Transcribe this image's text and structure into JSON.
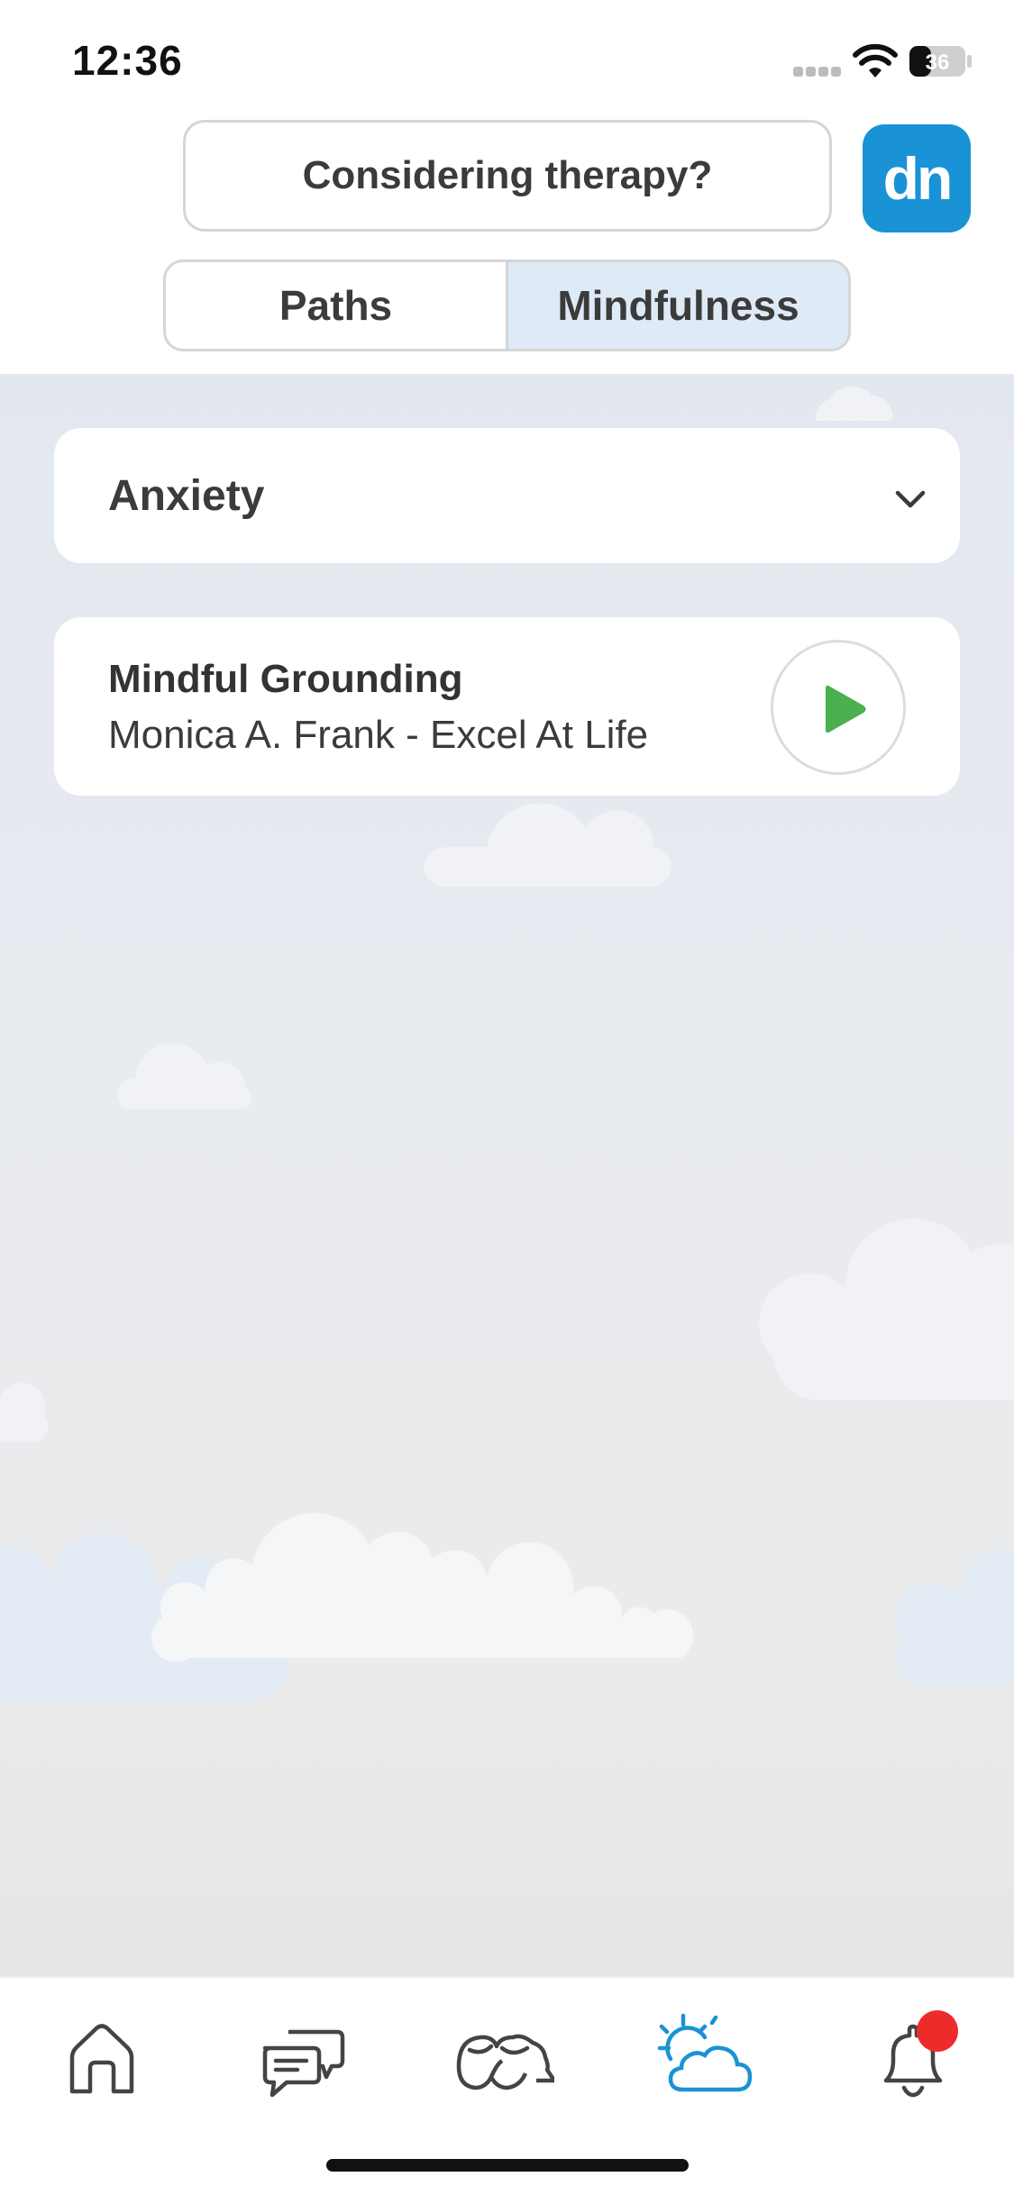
{
  "status_bar": {
    "time": "12:36",
    "battery": "36"
  },
  "header": {
    "therapy_button": "Considering therapy?",
    "logo_text": "dn",
    "logo_color": "#1a92d6"
  },
  "segments": [
    {
      "label": "Paths",
      "active": false
    },
    {
      "label": "Mindfulness",
      "active": true
    }
  ],
  "filter": {
    "selected": "Anxiety"
  },
  "tracks": [
    {
      "title": "Mindful Grounding",
      "author": "Monica A. Frank - Excel At Life"
    }
  ],
  "tab_bar": {
    "items": [
      {
        "icon": "home-icon",
        "active": false
      },
      {
        "icon": "chat-icon",
        "active": false
      },
      {
        "icon": "community-icon",
        "active": false
      },
      {
        "icon": "weather-icon",
        "active": true
      },
      {
        "icon": "bell-icon",
        "active": false,
        "has_badge": true
      }
    ],
    "active_color": "#1a92d6",
    "badge_color": "#ee2b2b"
  },
  "colors": {
    "play": "#4caf50"
  }
}
